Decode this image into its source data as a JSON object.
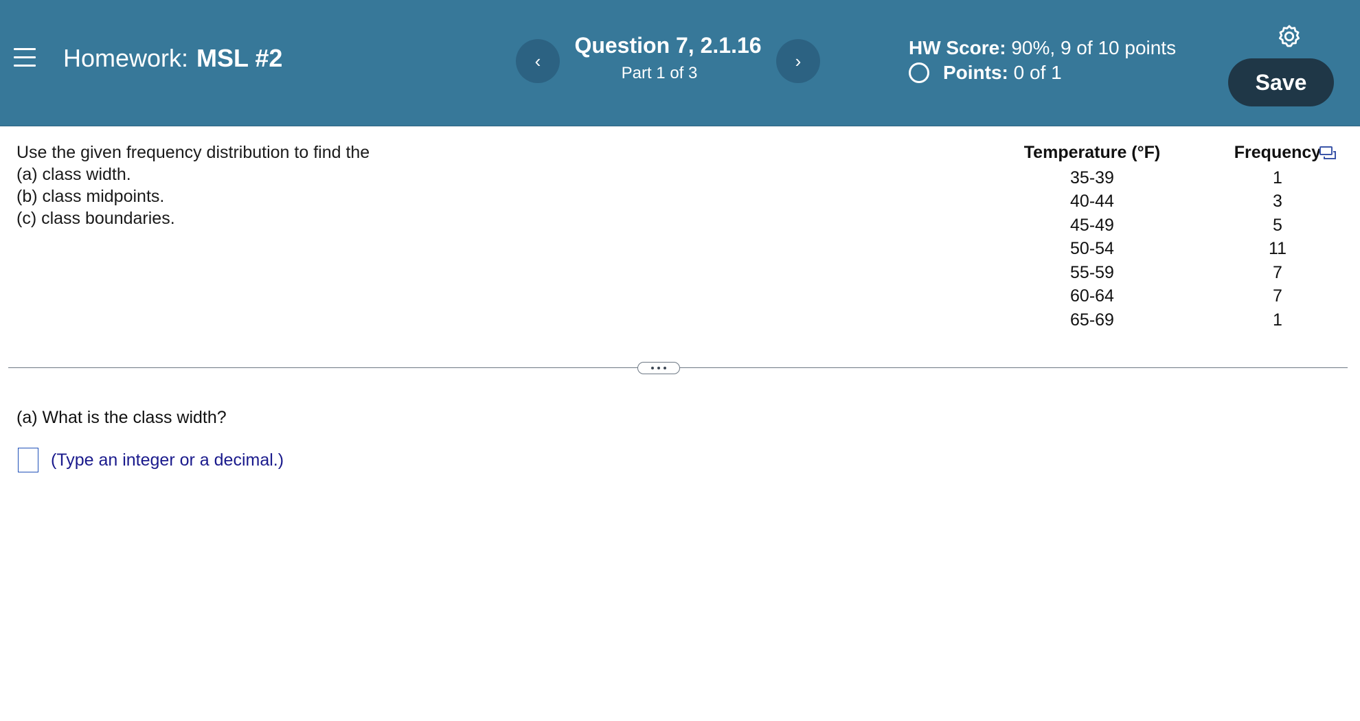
{
  "header": {
    "hw_label": "Homework:",
    "hw_name": "MSL #2",
    "question_title": "Question 7, 2.1.16",
    "question_part": "Part 1 of 3",
    "hw_score_label": "HW Score:",
    "hw_score_value": "90%, 9 of 10 points",
    "points_label": "Points:",
    "points_value": "0 of 1",
    "save_label": "Save",
    "prev_glyph": "‹",
    "next_glyph": "›"
  },
  "problem": {
    "lines": [
      "Use the given frequency distribution to find the",
      "(a) class width.",
      "(b) class midpoints.",
      "(c) class boundaries."
    ]
  },
  "table": {
    "headers": [
      "Temperature (°F)",
      "Frequency"
    ],
    "rows": [
      [
        "35-39",
        "1"
      ],
      [
        "40-44",
        "3"
      ],
      [
        "45-49",
        "5"
      ],
      [
        "50-54",
        "11"
      ],
      [
        "55-59",
        "7"
      ],
      [
        "60-64",
        "7"
      ],
      [
        "65-69",
        "1"
      ]
    ]
  },
  "question": {
    "prompt": "(a) What is the class width?",
    "answer_value": "",
    "hint": "(Type an integer or a decimal.)"
  },
  "icons": {
    "menu": "hamburger-menu-icon",
    "settings": "gear-icon",
    "copy": "copy-table-icon",
    "expand": "ellipsis-icon",
    "points_status": "circle-outline-icon"
  },
  "colors": {
    "header_bg": "#377899",
    "nav_button_bg": "#2c6282",
    "save_button_bg": "#1f3747",
    "hint_text": "#1a1a8c",
    "input_border": "#1f50b8"
  }
}
